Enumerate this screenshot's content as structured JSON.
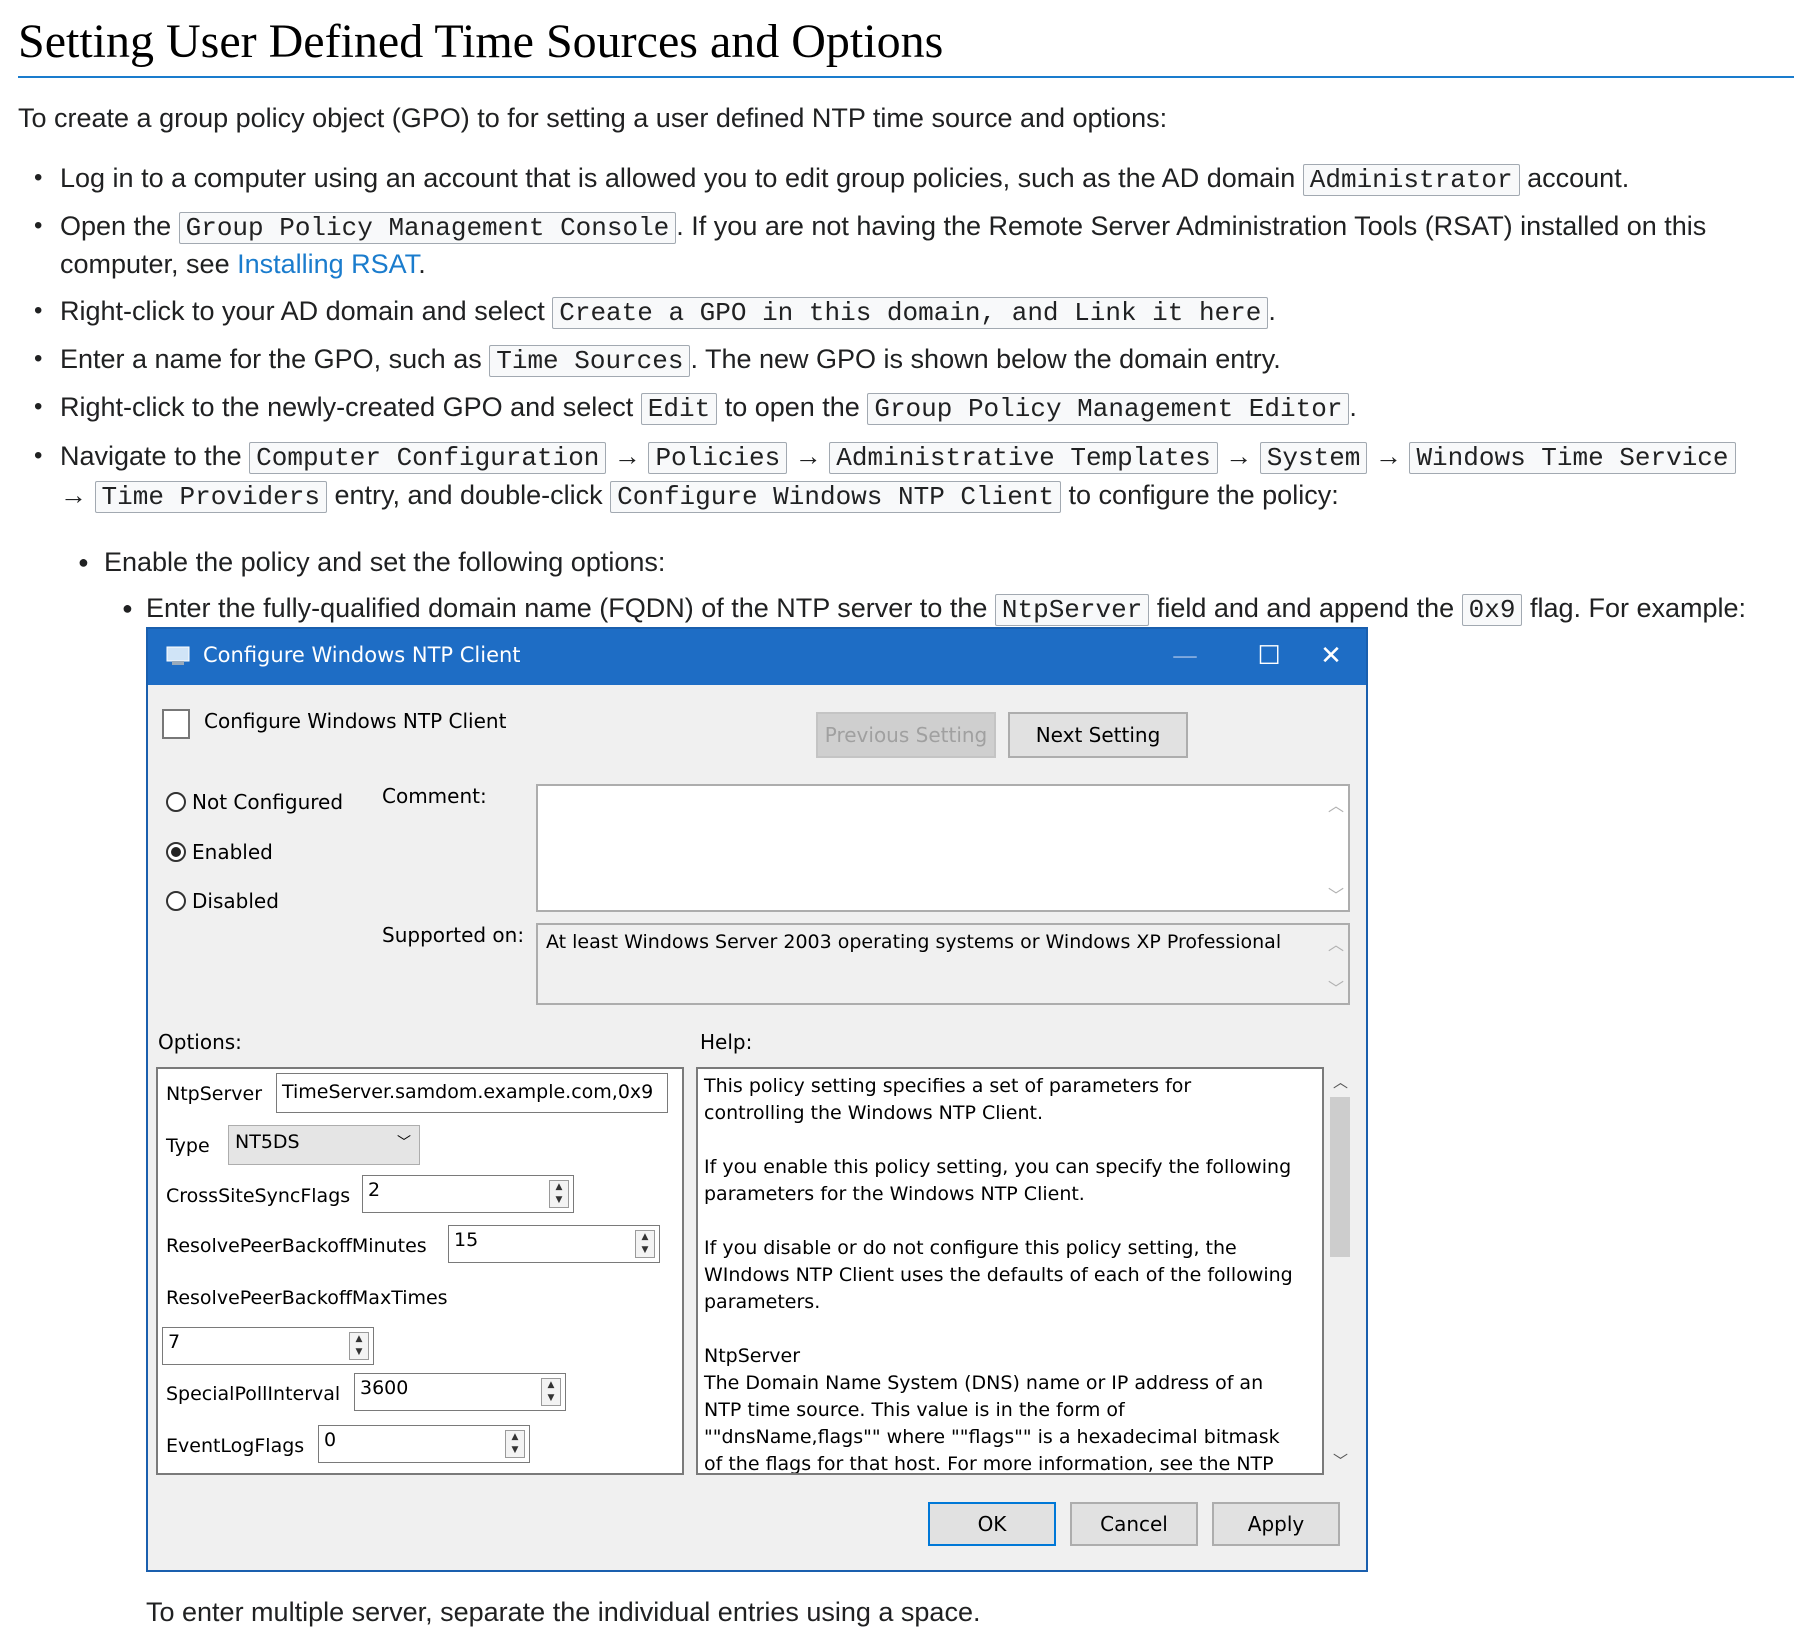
{
  "heading": "Setting User Defined Time Sources and Options",
  "intro": "To create a group policy object (GPO) to for setting a user defined NTP time source and options:",
  "steps": {
    "s1a": "Log in to a computer using an account that is allowed you to edit group policies, such as the AD domain",
    "s1code": "Administrator",
    "s1b": "account.",
    "s2a": "Open the",
    "s2code": "Group Policy Management Console",
    "s2b": ". If you are not having the Remote Server Administration Tools (RSAT) installed on this",
    "s2c": "computer, see",
    "s2link": "Installing RSAT",
    "s2d": ".",
    "s3a": "Right-click to your AD domain and select",
    "s3code": "Create a GPO in this domain, and Link it here",
    "s3b": ".",
    "s4a": "Enter a name for the GPO, such as",
    "s4code": "Time Sources",
    "s4b": ". The new GPO is shown below the domain entry.",
    "s5a": "Right-click to the newly-created GPO and select",
    "s5code1": "Edit",
    "s5b": "to open the",
    "s5code2": "Group Policy Management Editor",
    "s5c": ".",
    "s6a": "Navigate to the",
    "s6c1": "Computer Configuration",
    "s6c2": "Policies",
    "s6c3": "Administrative Templates",
    "s6c4": "System",
    "s6c5": "Windows Time Service",
    "s6c6": "Time Providers",
    "s6b": "entry, and double-click",
    "s6c7": "Configure Windows NTP Client",
    "s6d": "to configure the policy:",
    "arrow": "→",
    "sub1": "Enable the policy and set the following options:",
    "sub2a": "Enter the fully-qualified domain name (FQDN) of the NTP server to the",
    "sub2code1": "NtpServer",
    "sub2b": "field and and append the",
    "sub2code2": "0x9",
    "sub2c": "flag. For example:"
  },
  "dialog": {
    "title": "Configure Windows NTP Client",
    "header_title": "Configure Windows NTP Client",
    "prev_label": "Previous Setting",
    "next_label": "Next Setting",
    "radio_not_configured": "Not Configured",
    "radio_enabled": "Enabled",
    "radio_disabled": "Disabled",
    "comment_label": "Comment:",
    "supported_label": "Supported on:",
    "supported_text": "At least Windows Server 2003 operating systems or Windows XP Professional",
    "options_label": "Options:",
    "help_label": "Help:",
    "options": {
      "ntpserver_label": "NtpServer",
      "ntpserver_value": "TimeServer.samdom.example.com,0x9",
      "type_label": "Type",
      "type_value": "NT5DS",
      "crosssite_label": "CrossSiteSyncFlags",
      "crosssite_value": "2",
      "rpbm_label": "ResolvePeerBackoffMinutes",
      "rpbm_value": "15",
      "rpbmt_label": "ResolvePeerBackoffMaxTimes",
      "rpbmt_value": "7",
      "spi_label": "SpecialPollInterval",
      "spi_value": "3600",
      "elf_label": "EventLogFlags",
      "elf_value": "0"
    },
    "help_text": "This policy setting specifies a set of parameters for controlling the Windows NTP Client.\n\nIf you enable this policy setting, you can specify the following parameters for the Windows NTP Client.\n\nIf you disable or do not configure this policy setting, the WIndows NTP Client uses the defaults of each of the following parameters.\n\nNtpServer\nThe Domain Name System (DNS) name or IP address of an NTP time source. This value is in the form of \"\"dnsName,flags\"\" where \"\"flags\"\" is a hexadecimal bitmask of the flags for that host. For more information, see the NTP Client Group Policy",
    "ok_label": "OK",
    "cancel_label": "Cancel",
    "apply_label": "Apply"
  },
  "footer": "To enter multiple server, separate the individual entries using a space."
}
